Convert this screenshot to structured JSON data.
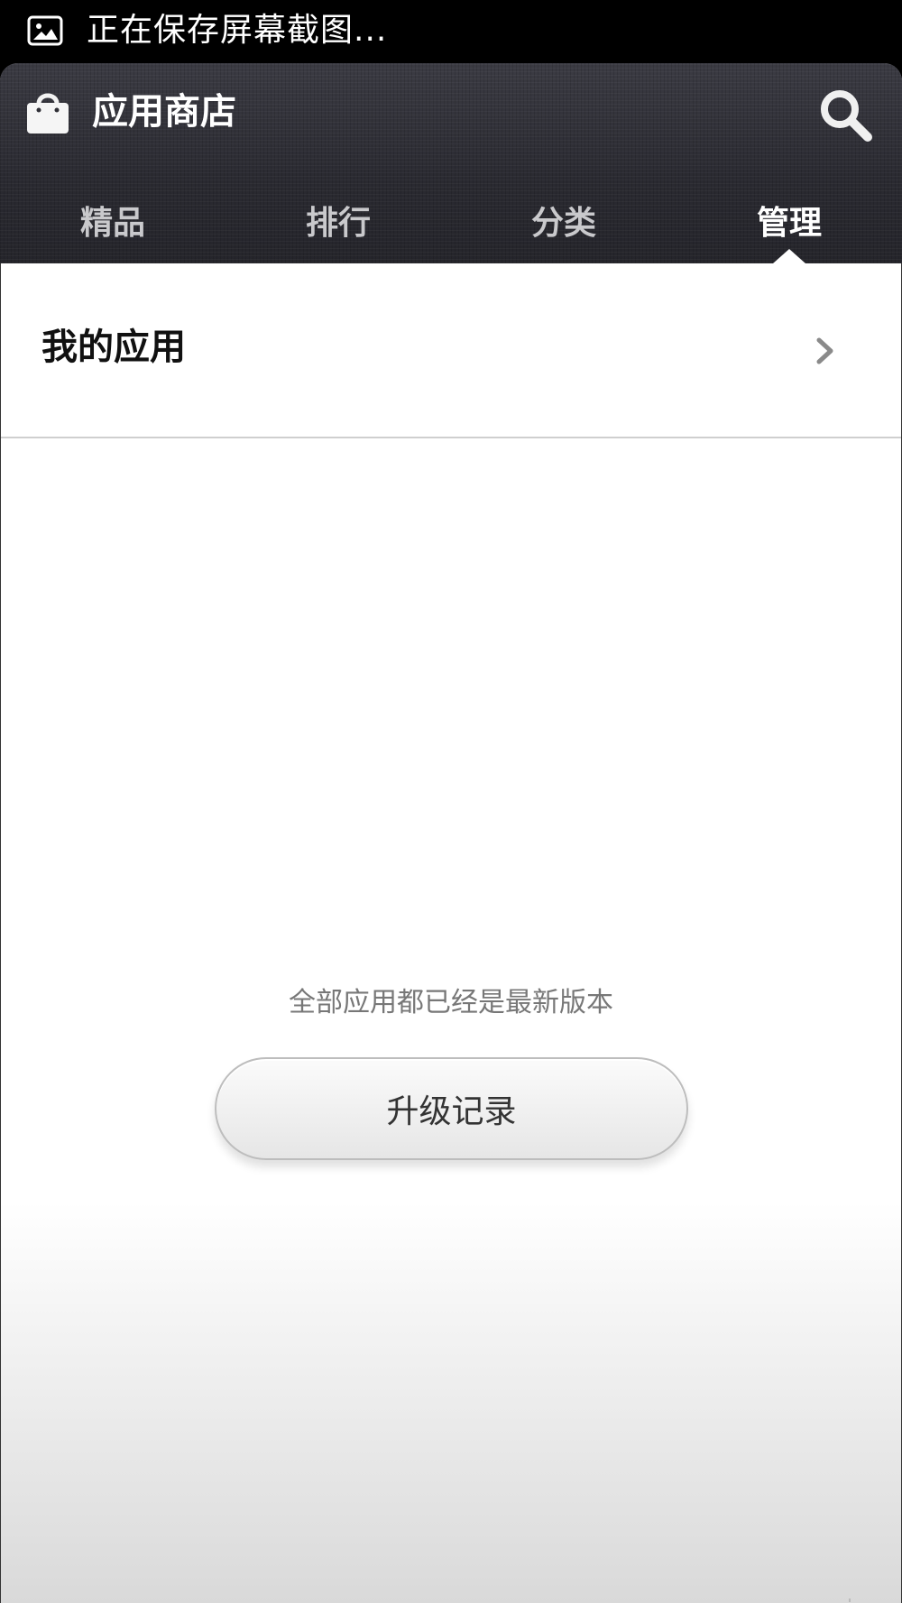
{
  "status_bar": {
    "text": "正在保存屏幕截图...",
    "icon": "screenshot-image-icon"
  },
  "header": {
    "title": "应用商店",
    "app_icon": "shopping-bag-icon",
    "search_icon": "search-icon"
  },
  "tabs": [
    {
      "label": "精品",
      "active": false
    },
    {
      "label": "排行",
      "active": false
    },
    {
      "label": "分类",
      "active": false
    },
    {
      "label": "管理",
      "active": true
    }
  ],
  "main": {
    "my_apps_label": "我的应用",
    "chevron_icon": "chevron-right-icon",
    "status_message": "全部应用都已经是最新版本",
    "history_button_label": "升级记录"
  },
  "colors": {
    "header_bg": "#2f2f36",
    "tab_text": "#c9c9cc",
    "tab_active_text": "#ffffff",
    "status_message": "#777777"
  }
}
